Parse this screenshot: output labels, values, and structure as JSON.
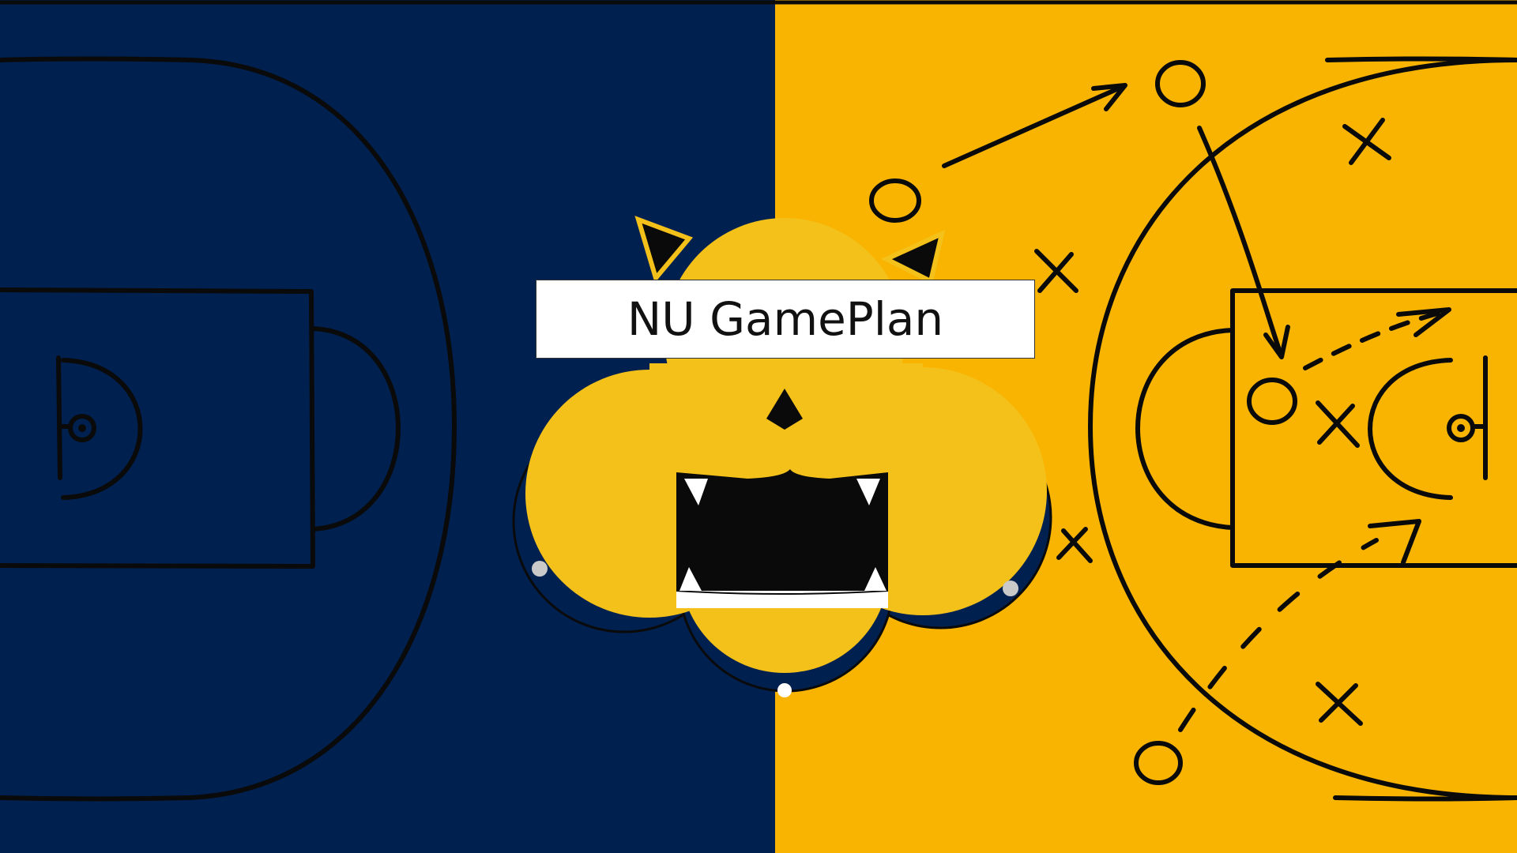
{
  "app": {
    "title": "NU GamePlan"
  },
  "theme": {
    "court_left_color": "#00204F",
    "court_right_color": "#F9B401",
    "mascot_face_color": "#F3C11A",
    "mascot_shadow_color": "#00204F",
    "chalk_line_color": "#0A0A0A",
    "title_box_color": "#FFFFFF",
    "title_text_color": "#111111"
  },
  "illustration": {
    "left_court": "basketball-half-court-navy",
    "right_court": "basketball-half-court-gold-play-diagram",
    "mascot": "cat-mascot-face-icon",
    "play_symbols": [
      "o-player-icon",
      "x-defender-icon",
      "pass-arrow-icon",
      "dashed-cut-arrow-icon"
    ]
  }
}
